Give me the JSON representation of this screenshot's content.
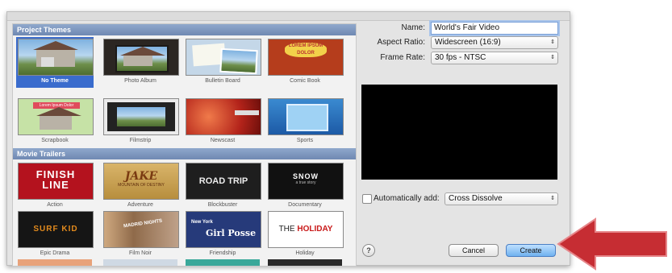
{
  "dialog": {
    "project_themes": {
      "header": "Project Themes",
      "items": [
        {
          "label": "No Theme",
          "selected": true
        },
        {
          "label": "Photo Album"
        },
        {
          "label": "Bulletin Board"
        },
        {
          "label": "Comic Book"
        },
        {
          "label": "Scrapbook"
        },
        {
          "label": "Filmstrip"
        },
        {
          "label": "Newscast"
        },
        {
          "label": "Sports"
        }
      ],
      "thumb_text": {
        "comic": "LOREM IPSUM DOLOR",
        "scrapbook": "Lorem Ipsum Dolor"
      }
    },
    "movie_trailers": {
      "header": "Movie Trailers",
      "items": [
        {
          "label": "Action",
          "thumb_lines": [
            "FINISH",
            "LINE"
          ]
        },
        {
          "label": "Adventure",
          "thumb_big": "JAKE",
          "thumb_small": "MOUNTAIN OF DESTINY"
        },
        {
          "label": "Blockbuster",
          "thumb_big": "ROAD TRIP"
        },
        {
          "label": "Documentary",
          "thumb_big": "SNOW",
          "thumb_small": "a true story"
        },
        {
          "label": "Epic Drama",
          "thumb_big": "SURF KID"
        },
        {
          "label": "Film Noir",
          "thumb_big": "MADRID NIGHTS"
        },
        {
          "label": "Friendship",
          "thumb_small": "New York",
          "thumb_big": "Girl Posse"
        },
        {
          "label": "Holiday",
          "thumb_prefix": "THE",
          "thumb_big": "HOLIDAY"
        }
      ]
    },
    "form": {
      "name_label": "Name:",
      "name_value": "World's Fair Video",
      "aspect_label": "Aspect Ratio:",
      "aspect_value": "Widescreen (16:9)",
      "frame_label": "Frame Rate:",
      "frame_value": "30 fps - NTSC",
      "auto_add_label": "Automatically add:",
      "auto_add_value": "Cross Dissolve",
      "auto_add_checked": false
    },
    "buttons": {
      "help": "?",
      "cancel": "Cancel",
      "create": "Create"
    }
  },
  "colors": {
    "selection": "#3a6ccd",
    "section_header": "#7b93bb",
    "annotation_arrow": "#c62d33"
  }
}
